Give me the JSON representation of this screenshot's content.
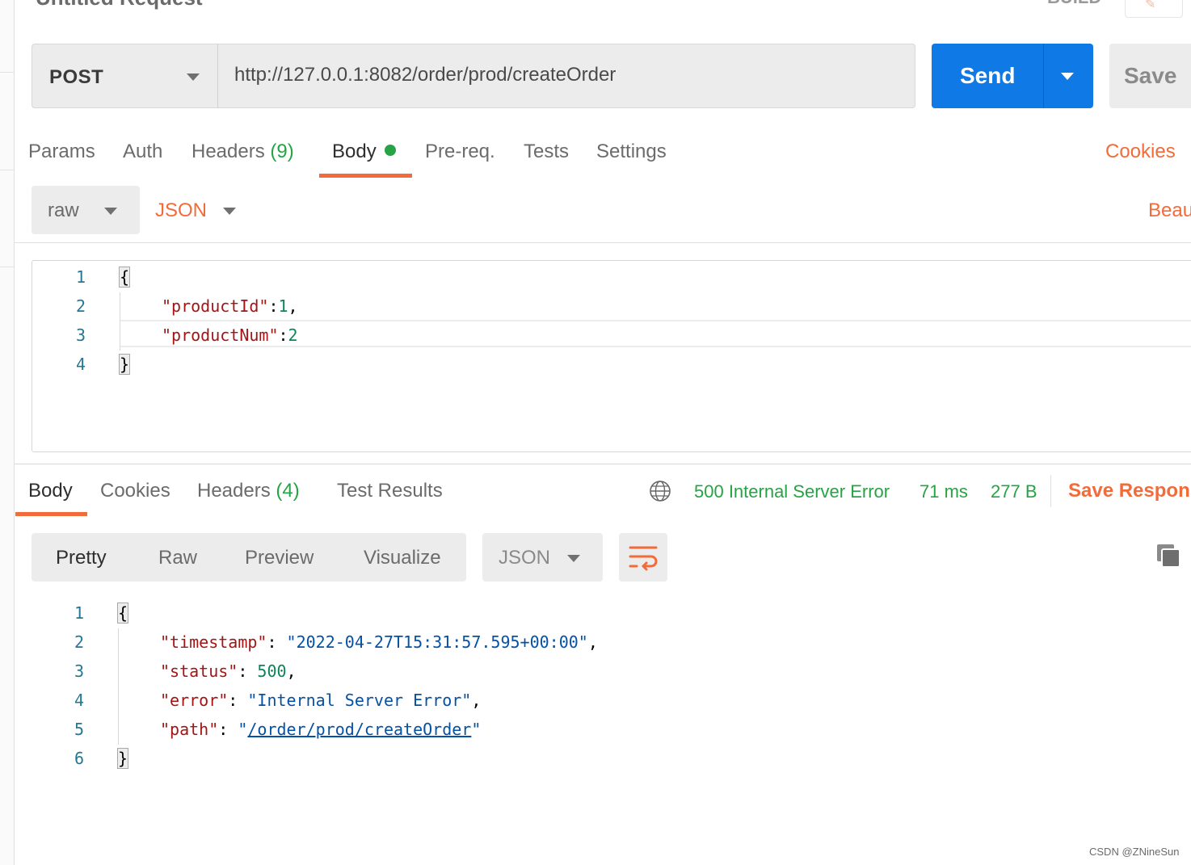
{
  "header": {
    "title": "Untitled Request",
    "right_label": "BUILD"
  },
  "request": {
    "method": "POST",
    "url": "http://127.0.0.1:8082/order/prod/createOrder",
    "send_label": "Send",
    "save_label": "Save"
  },
  "request_tabs": {
    "params": "Params",
    "auth": "Auth",
    "headers": "Headers",
    "headers_count": "(9)",
    "body": "Body",
    "prereq": "Pre-req.",
    "tests": "Tests",
    "settings": "Settings",
    "cookies": "Cookies"
  },
  "body_type": {
    "mode": "raw",
    "language": "JSON",
    "beautify": "Beau"
  },
  "request_body": {
    "line_numbers": [
      "1",
      "2",
      "3",
      "4"
    ],
    "open_brace": "{",
    "close_brace": "}",
    "key1": "\"productId\"",
    "val1": "1",
    "key2": "\"productNum\"",
    "val2": "2"
  },
  "response_tabs": {
    "body": "Body",
    "cookies": "Cookies",
    "headers": "Headers",
    "headers_count": "(4)",
    "test_results": "Test Results"
  },
  "response_status": {
    "status": "500 Internal Server Error",
    "time": "71 ms",
    "size": "277 B",
    "save_response": "Save Respons"
  },
  "response_view": {
    "pretty": "Pretty",
    "raw": "Raw",
    "preview": "Preview",
    "visualize": "Visualize",
    "format": "JSON"
  },
  "response_body": {
    "line_numbers": [
      "1",
      "2",
      "3",
      "4",
      "5",
      "6"
    ],
    "open_brace": "{",
    "close_brace": "}",
    "k_timestamp": "\"timestamp\"",
    "v_timestamp": "\"2022-04-27T15:31:57.595+00:00\"",
    "k_status": "\"status\"",
    "v_status": "500",
    "k_error": "\"error\"",
    "v_error": "\"Internal Server Error\"",
    "k_path": "\"path\"",
    "v_path_q1": "\"",
    "v_path": "/order/prod/createOrder",
    "v_path_q2": "\""
  },
  "watermark": "CSDN @ZNineSun",
  "colors": {
    "accent": "#f26b3a",
    "send_blue": "#0f7ae5",
    "status_green": "#26a344"
  }
}
